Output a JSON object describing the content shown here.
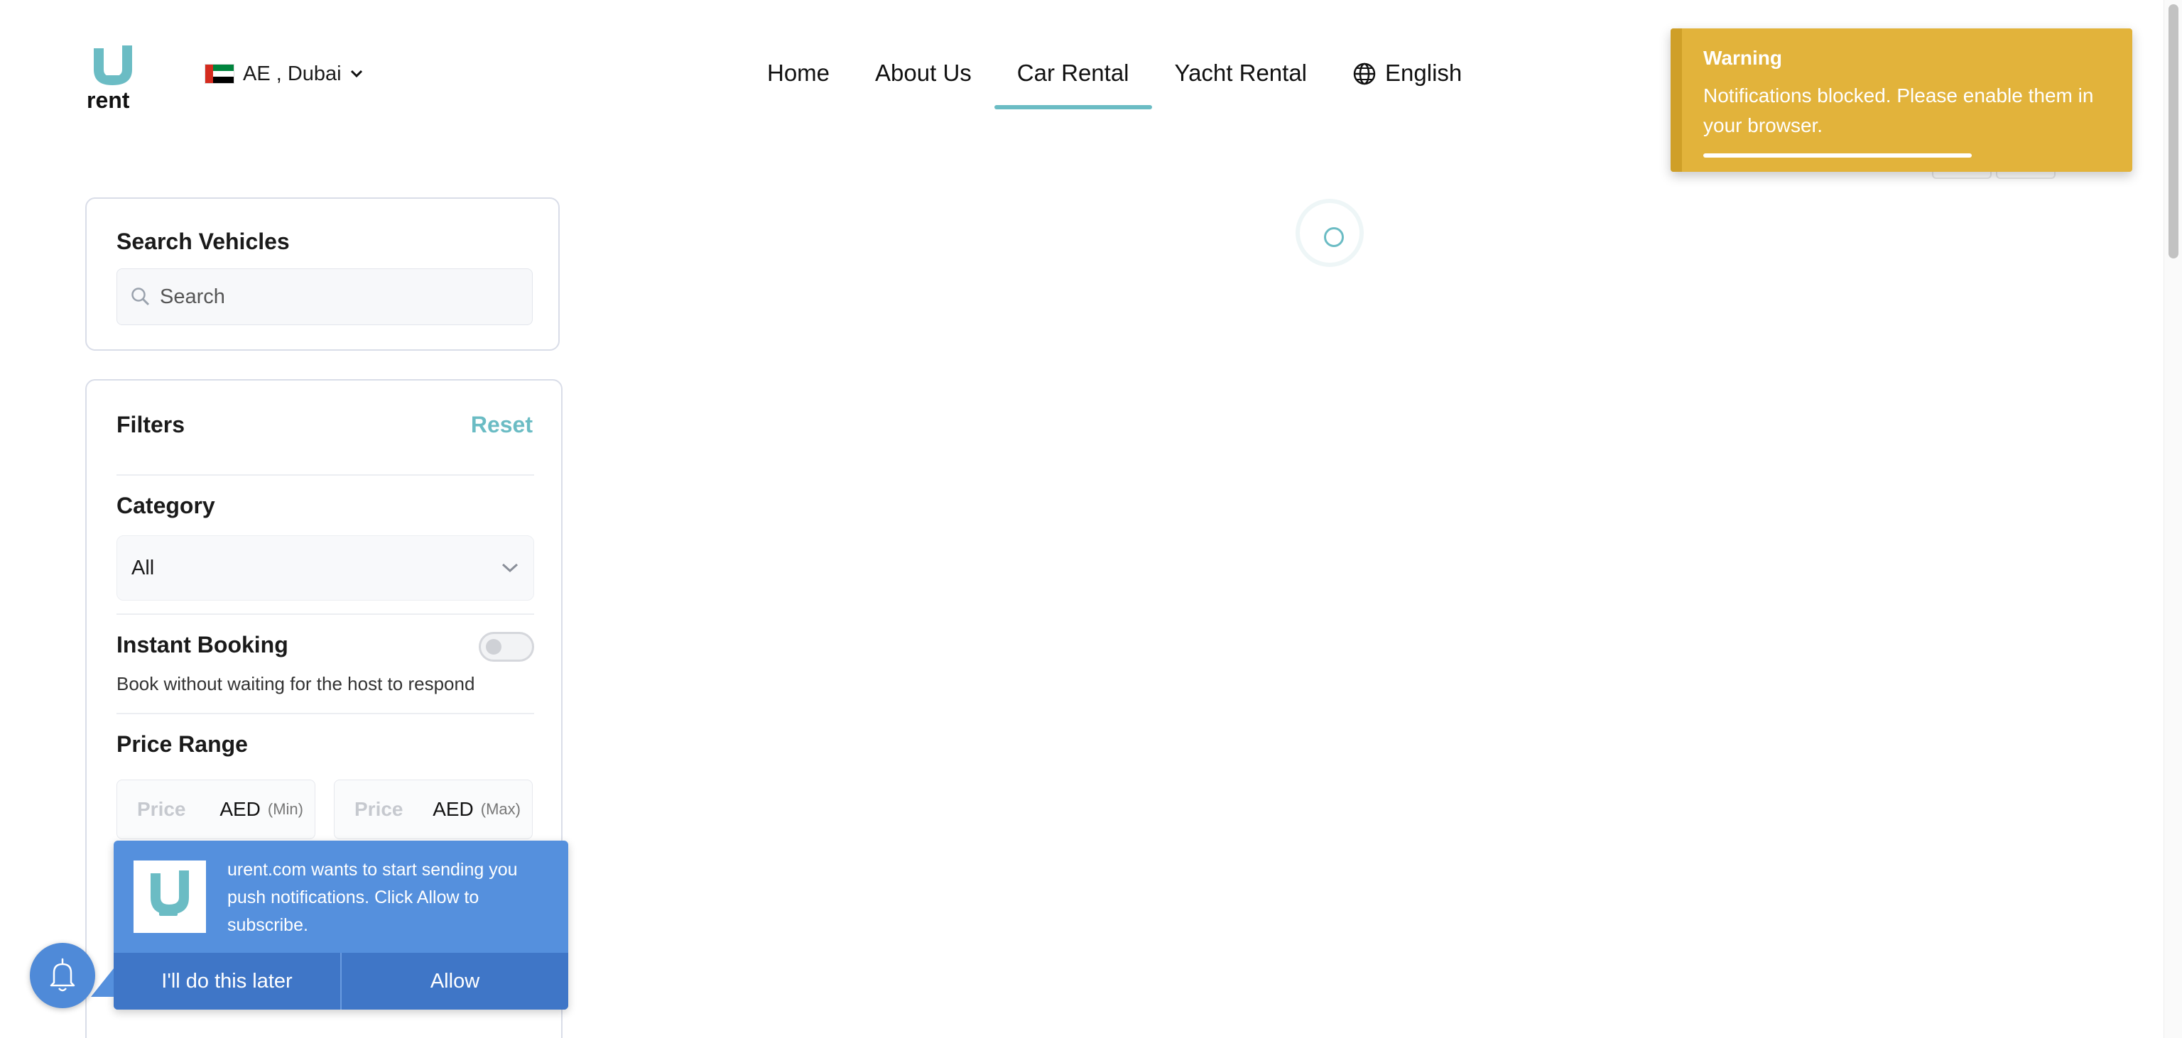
{
  "header": {
    "logo_text": "rent",
    "location": "AE , Dubai",
    "nav": [
      {
        "label": "Home"
      },
      {
        "label": "About Us"
      },
      {
        "label": "Car Rental",
        "active": true
      },
      {
        "label": "Yacht Rental"
      }
    ],
    "language": "English"
  },
  "toast": {
    "title": "Warning",
    "message": "Notifications blocked. Please enable them in your browser.",
    "color": "#e2b33b"
  },
  "search": {
    "title": "Search Vehicles",
    "placeholder": "Search"
  },
  "filters": {
    "title": "Filters",
    "reset": "Reset",
    "category": {
      "title": "Category",
      "value": "All"
    },
    "instant_booking": {
      "title": "Instant Booking",
      "description": "Book without waiting for the host to respond",
      "enabled": false
    },
    "price_range": {
      "title": "Price Range",
      "min": {
        "placeholder": "Price",
        "currency": "AED",
        "tag": "(Min)"
      },
      "max": {
        "placeholder": "Price",
        "currency": "AED",
        "tag": "(Max)"
      }
    }
  },
  "push_prompt": {
    "message": "urent.com wants to start sending you push notifications. Click Allow to subscribe.",
    "later": "I'll do this later",
    "allow": "Allow"
  },
  "colors": {
    "accent": "#6bbcc4",
    "push_blue": "#5590dd",
    "warning": "#e2b33b"
  },
  "icons": [
    "globe-icon",
    "search-icon",
    "chevron-down-icon",
    "bell-icon"
  ]
}
